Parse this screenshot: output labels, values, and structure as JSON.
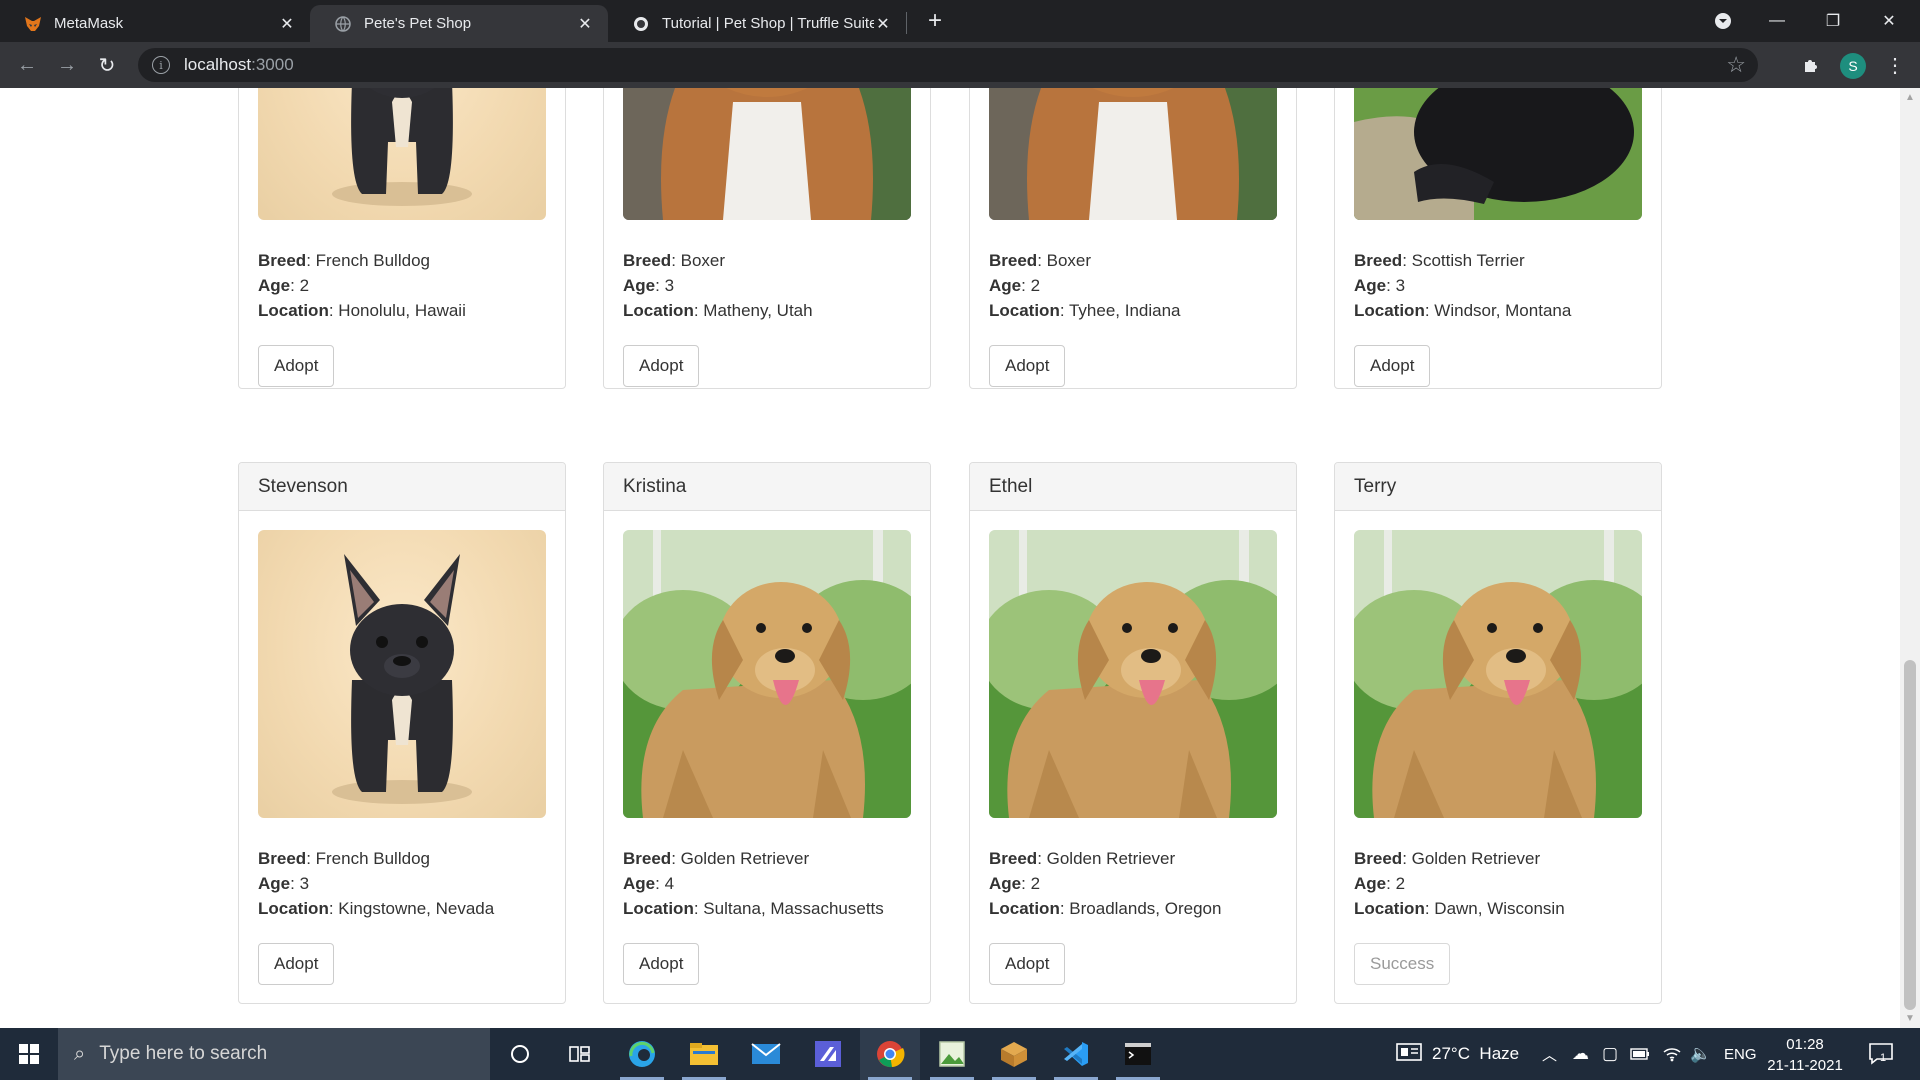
{
  "browser": {
    "tabs": [
      {
        "title": "MetaMask",
        "active": false
      },
      {
        "title": "Pete's Pet Shop",
        "active": true
      },
      {
        "title": "Tutorial | Pet Shop | Truffle Suite",
        "active": false
      }
    ],
    "address_host": "localhost",
    "address_port": ":3000",
    "profile_initial": "S"
  },
  "pets": [
    {
      "name": "",
      "image": "bulldog",
      "breed_label": "Breed",
      "breed": ": French Bulldog",
      "age_label": "Age",
      "age": ": 2",
      "location_label": "Location",
      "location": ": Honolulu, Hawaii",
      "button": "Adopt",
      "adopted": false
    },
    {
      "name": "",
      "image": "boxer",
      "breed_label": "Breed",
      "breed": ": Boxer",
      "age_label": "Age",
      "age": ": 3",
      "location_label": "Location",
      "location": ": Matheny, Utah",
      "button": "Adopt",
      "adopted": false
    },
    {
      "name": "",
      "image": "boxer",
      "breed_label": "Breed",
      "breed": ": Boxer",
      "age_label": "Age",
      "age": ": 2",
      "location_label": "Location",
      "location": ": Tyhee, Indiana",
      "button": "Adopt",
      "adopted": false
    },
    {
      "name": "",
      "image": "terrier",
      "breed_label": "Breed",
      "breed": ": Scottish Terrier",
      "age_label": "Age",
      "age": ": 3",
      "location_label": "Location",
      "location": ": Windsor, Montana",
      "button": "Adopt",
      "adopted": false
    },
    {
      "name": "Stevenson",
      "image": "bulldog",
      "breed_label": "Breed",
      "breed": ": French Bulldog",
      "age_label": "Age",
      "age": ": 3",
      "location_label": "Location",
      "location": ": Kingstowne, Nevada",
      "button": "Adopt",
      "adopted": false
    },
    {
      "name": "Kristina",
      "image": "golden",
      "breed_label": "Breed",
      "breed": ": Golden Retriever",
      "age_label": "Age",
      "age": ": 4",
      "location_label": "Location",
      "location": ": Sultana, Massachusetts",
      "button": "Adopt",
      "adopted": false
    },
    {
      "name": "Ethel",
      "image": "golden",
      "breed_label": "Breed",
      "breed": ": Golden Retriever",
      "age_label": "Age",
      "age": ": 2",
      "location_label": "Location",
      "location": ": Broadlands, Oregon",
      "button": "Adopt",
      "adopted": false
    },
    {
      "name": "Terry",
      "image": "golden",
      "breed_label": "Breed",
      "breed": ": Golden Retriever",
      "age_label": "Age",
      "age": ": 2",
      "location_label": "Location",
      "location": ": Dawn, Wisconsin",
      "button": "Success",
      "adopted": true
    }
  ],
  "taskbar": {
    "search_placeholder": "Type here to search",
    "weather": "27°C  Haze",
    "language": "ENG",
    "time": "01:28",
    "date": "21-11-2021",
    "notification_count": "1",
    "apps": [
      "cortana",
      "task-view",
      "edge",
      "file-explorer",
      "mail",
      "visual-studio",
      "chrome",
      "image-viewer",
      "package-app",
      "vscode",
      "terminal"
    ]
  },
  "colors": {
    "chrome_dark": "#202124",
    "chrome_toolbar": "#35363a",
    "card_header": "#f5f5f5",
    "taskbar": "#1f2b3a",
    "adopted_button_text": "#9a9a9a"
  }
}
